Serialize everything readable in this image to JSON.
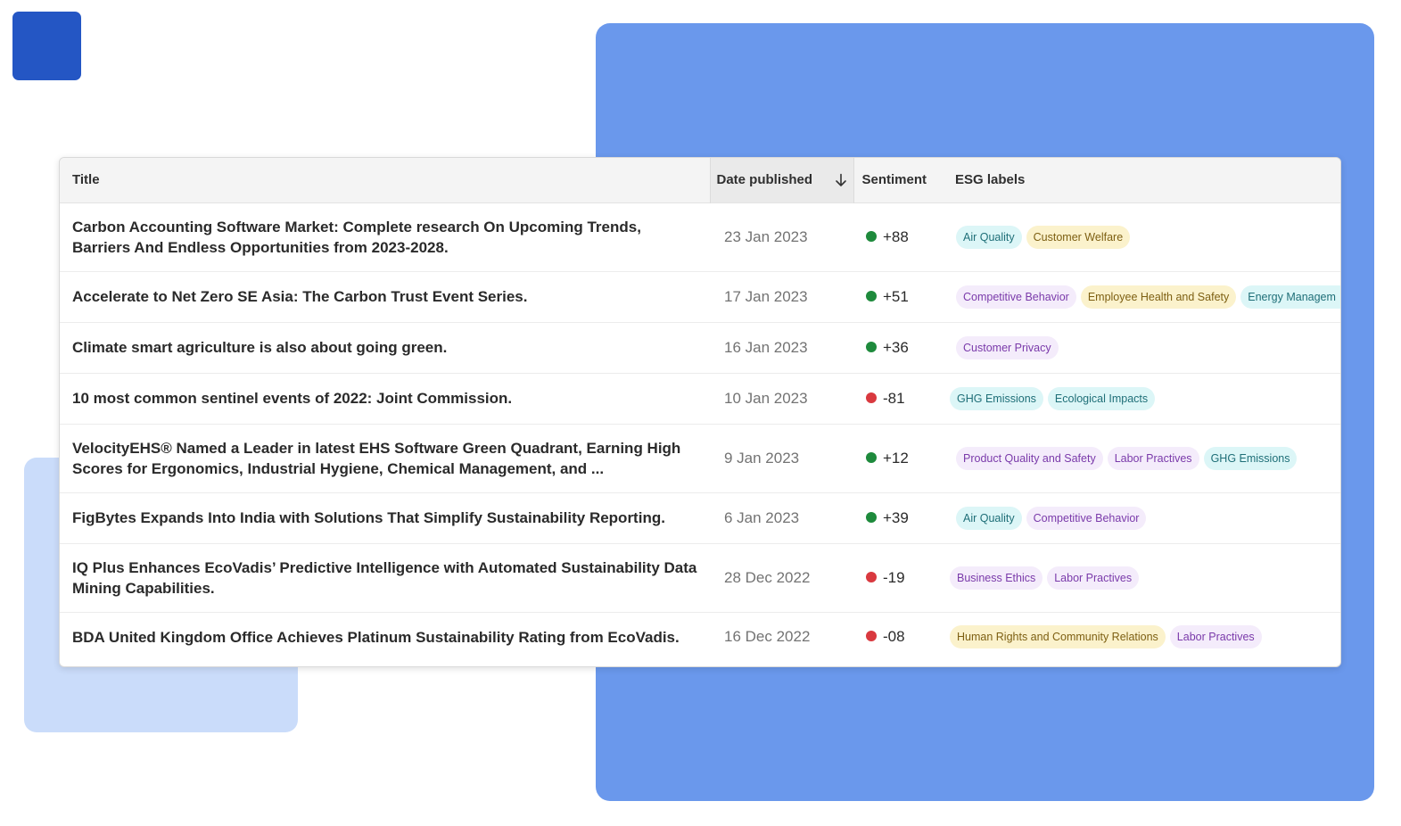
{
  "colors": {
    "accent_dark": "#2456c4",
    "accent_mid": "#6a98ec",
    "accent_light": "#cadcfa",
    "positive": "#1e8a3c",
    "negative": "#d9393f",
    "tag_teal": "#dcf6f7",
    "tag_yellow": "#fbf2cc",
    "tag_purple": "#f4ecfb"
  },
  "table": {
    "headers": {
      "title": "Title",
      "date": "Date published",
      "sentiment": "Sentiment",
      "labels": "ESG labels"
    },
    "sort": {
      "column": "date",
      "direction": "descending",
      "icon": "arrow-down-icon"
    },
    "rows": [
      {
        "title": "Carbon Accounting Software Market: Complete research On Upcoming Trends, Barriers And Endless Opportunities from 2023-2028.",
        "date": "23 Jan 2023",
        "sentiment": "+88",
        "polarity": "positive",
        "labels": [
          {
            "text": "Air Quality",
            "color": "teal"
          },
          {
            "text": "Customer Welfare",
            "color": "yellow"
          }
        ]
      },
      {
        "title": "Accelerate to Net Zero SE Asia: The Carbon Trust Event Series.",
        "date": "17 Jan 2023",
        "sentiment": "+51",
        "polarity": "positive",
        "labels": [
          {
            "text": "Competitive Behavior",
            "color": "purple"
          },
          {
            "text": "Employee Health and Safety",
            "color": "yellow"
          },
          {
            "text": "Energy Managem",
            "color": "teal"
          }
        ]
      },
      {
        "title": "Climate smart agriculture is also about going green.",
        "date": "16 Jan 2023",
        "sentiment": "+36",
        "polarity": "positive",
        "labels": [
          {
            "text": "Customer Privacy",
            "color": "purple"
          }
        ]
      },
      {
        "title": "10 most common sentinel events of 2022: Joint Commission.",
        "date": "10 Jan 2023",
        "sentiment": "-81",
        "polarity": "negative",
        "labels": [
          {
            "text": "GHG Emissions",
            "color": "teal"
          },
          {
            "text": "Ecological Impacts",
            "color": "teal"
          }
        ]
      },
      {
        "title": "VelocityEHS® Named a Leader in latest EHS Software Green Quadrant, Earning High Scores for Ergonomics, Industrial Hygiene, Chemical Management, and ...",
        "date": "9 Jan 2023",
        "sentiment": "+12",
        "polarity": "positive",
        "labels": [
          {
            "text": "Product Quality and Safety",
            "color": "purple"
          },
          {
            "text": "Labor Practives",
            "color": "purple"
          },
          {
            "text": "GHG Emissions",
            "color": "teal"
          }
        ]
      },
      {
        "title": "FigBytes Expands Into India with Solutions That Simplify Sustainability Reporting.",
        "date": "6 Jan 2023",
        "sentiment": "+39",
        "polarity": "positive",
        "labels": [
          {
            "text": "Air Quality",
            "color": "teal"
          },
          {
            "text": "Competitive Behavior",
            "color": "purple"
          }
        ]
      },
      {
        "title": "IQ Plus Enhances EcoVadis’ Predictive Intelligence with Automated Sustainability Data Mining Capabilities.",
        "date": "28 Dec 2022",
        "sentiment": "-19",
        "polarity": "negative",
        "labels": [
          {
            "text": "Business Ethics",
            "color": "purple"
          },
          {
            "text": "Labor Practives",
            "color": "purple"
          }
        ]
      },
      {
        "title": "BDA United Kingdom Office Achieves Platinum Sustainability Rating from EcoVadis.",
        "date": "16 Dec 2022",
        "sentiment": "-08",
        "polarity": "negative",
        "labels": [
          {
            "text": "Human Rights and Community Relations",
            "color": "yellow"
          },
          {
            "text": "Labor Practives",
            "color": "purple"
          }
        ]
      }
    ]
  }
}
